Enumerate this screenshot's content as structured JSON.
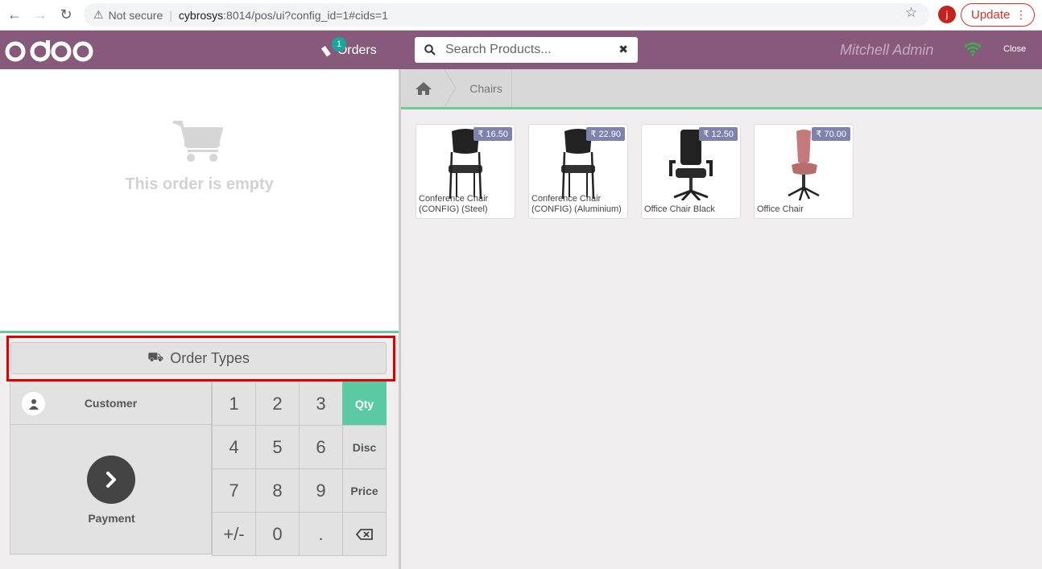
{
  "browser": {
    "security_label": "Not secure",
    "url_host": "cybrosys",
    "url_path": ":8014/pos/ui?config_id=1#cids=1",
    "profile_initial": "j",
    "update_label": "Update"
  },
  "header": {
    "orders_label": "Orders",
    "orders_count": "1",
    "search_placeholder": "Search Products...",
    "cashier": "Mitchell Admin",
    "close_label": "Close",
    "brand_color": "#875a7b"
  },
  "order": {
    "empty_text": "This order is empty",
    "order_types_label": "Order Types"
  },
  "pad": {
    "customer_label": "Customer",
    "payment_label": "Payment",
    "keys": [
      "1",
      "2",
      "3",
      "4",
      "5",
      "6",
      "7",
      "8",
      "9",
      "+/-",
      "0",
      "."
    ],
    "modes": [
      "Qty",
      "Disc",
      "Price"
    ],
    "active_mode": "Qty",
    "accent_color": "#5cc9a5"
  },
  "breadcrumb": {
    "category": "Chairs"
  },
  "products": [
    {
      "name": "Conference Chair (CONFIG) (Steel)",
      "price": "₹ 16.50"
    },
    {
      "name": "Conference Chair (CONFIG) (Aluminium)",
      "price": "₹ 22.90"
    },
    {
      "name": "Office Chair Black",
      "price": "₹ 12.50"
    },
    {
      "name": "Office Chair",
      "price": "₹ 70.00"
    }
  ]
}
